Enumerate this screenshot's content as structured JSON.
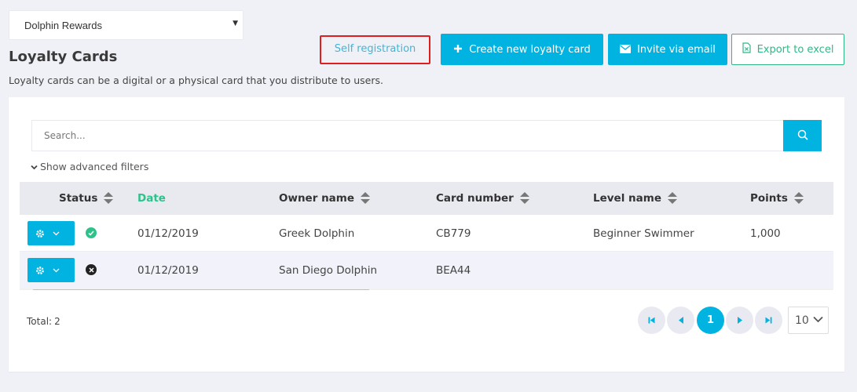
{
  "program_select": {
    "value": "Dolphin Rewards"
  },
  "page": {
    "title": "Loyalty Cards",
    "description": "Loyalty cards can be a digital or a physical card that you distribute to users."
  },
  "actions": {
    "self_registration": "Self registration",
    "create_card": "Create new loyalty card",
    "invite_email": "Invite via email",
    "export_excel": "Export to excel"
  },
  "search": {
    "placeholder": "Search...",
    "value": ""
  },
  "advanced_filters": "Show advanced filters",
  "table": {
    "columns": {
      "status": "Status",
      "date": "Date",
      "owner": "Owner name",
      "card_number": "Card number",
      "level": "Level name",
      "points": "Points"
    },
    "rows": [
      {
        "status": "active",
        "date": "01/12/2019",
        "owner": "Greek Dolphin",
        "card_number": "CB779",
        "level": "Beginner Swimmer",
        "points": "1,000"
      },
      {
        "status": "inactive",
        "date": "01/12/2019",
        "owner": "San Diego Dolphin",
        "card_number": "BEA44",
        "level": "",
        "points": ""
      }
    ]
  },
  "footer": {
    "total_label": "Total:",
    "total_value": "2"
  },
  "pagination": {
    "current_page": "1",
    "per_page": "10"
  },
  "colors": {
    "accent": "#00b3e0",
    "success": "#2eb885",
    "active_status": "#2dc28a",
    "highlight_border": "#e01e1e"
  },
  "icons": {
    "plus": "plus-icon",
    "envelope": "envelope-icon",
    "excel": "excel-file-icon",
    "search": "search-icon",
    "gear": "gear-icon",
    "check": "check-circle-icon",
    "cross": "x-circle-icon"
  }
}
